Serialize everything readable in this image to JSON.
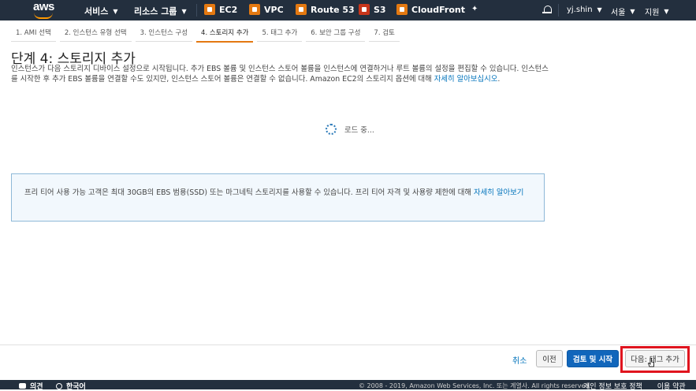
{
  "topnav": {
    "logo": "aws",
    "services_label": "서비스",
    "resource_groups_label": "리소스 그룹",
    "services": [
      {
        "label": "EC2",
        "icon": "ec2-icon"
      },
      {
        "label": "VPC",
        "icon": "vpc-icon"
      },
      {
        "label": "Route 53",
        "icon": "route53-icon"
      },
      {
        "label": "S3",
        "icon": "s3-icon"
      },
      {
        "label": "CloudFront",
        "icon": "cloudfront-icon"
      }
    ],
    "user": "yj.shin",
    "region": "서울",
    "support": "지원"
  },
  "wizard_tabs": [
    {
      "label": "1. AMI 선택"
    },
    {
      "label": "2. 인스턴스 유형 선택"
    },
    {
      "label": "3. 인스턴스 구성"
    },
    {
      "label": "4. 스토리지 추가",
      "active": true
    },
    {
      "label": "5. 태그 추가"
    },
    {
      "label": "6. 보안 그룹 구성"
    },
    {
      "label": "7. 검토"
    }
  ],
  "page": {
    "title": "단계 4: 스토리지 추가",
    "description": "인스턴스가 다음 스토리지 디바이스 설정으로 시작됩니다. 추가 EBS 볼륨 및 인스턴스 스토어 볼륨을 인스턴스에 연결하거나 루트 볼륨의 설정을 편집할 수 있습니다. 인스턴스를 시작한 후 추가 EBS 볼륨을 연결할 수도 있지만, 인스턴스 스토어 볼륨은 연결할 수 없습니다. Amazon EC2의 스토리지 옵션에 대해 ",
    "description_link": "자세히 알아보십시오",
    "description_end": ".",
    "loading": "로드 중...",
    "info_text": "프리 티어 사용 가능 고객은 최대 30GB의 EBS 범용(SSD) 또는 마그네틱 스토리지를 사용할 수 있습니다. 프리 티어 자격 및 사용량 제한에 대해 ",
    "info_link": "자세히 알아보기"
  },
  "actions": {
    "cancel": "취소",
    "previous": "이전",
    "review_launch": "검토 및 시작",
    "next": "다음: 태그 추가"
  },
  "footer": {
    "feedback": "의견",
    "language": "한국어",
    "copyright": "© 2008 - 2019, Amazon Web Services, Inc. 또는 계열사. All rights reserved.",
    "privacy": "개인 정보 보호 정책",
    "terms": "이용 약관"
  },
  "colors": {
    "nav_bg": "#232f3e",
    "accent": "#e47911",
    "link": "#0073bb",
    "primary_button": "#1166bb",
    "highlight": "#e0141e"
  }
}
